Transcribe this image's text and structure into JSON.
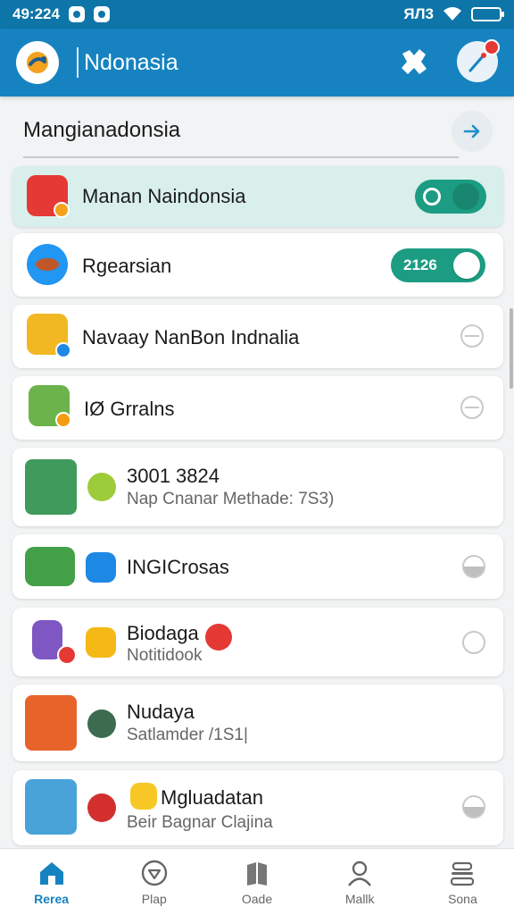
{
  "status": {
    "time": "49:224",
    "network": "ЯЛ3"
  },
  "app": {
    "title": "Ndonasia"
  },
  "search": {
    "text": "Mangianadonsia"
  },
  "list": [
    {
      "label": "Manan Naindonsia",
      "control": "toggle-on"
    },
    {
      "label": "Rgearsian",
      "control": "toggle-version",
      "version": "2126"
    },
    {
      "label": "Navaay NanBon Indnalia",
      "control": "radio-barred"
    },
    {
      "label": "IØ Grralns",
      "control": "radio-barred"
    },
    {
      "label": "3001 3824",
      "sub": "Nap Cnanar Methade: 7S3)"
    },
    {
      "label": "INGICrosas",
      "control": "radio-filled"
    },
    {
      "label": "Biodaga",
      "sub": "Notitidook",
      "control": "radio-empty"
    },
    {
      "label": "Nudaya",
      "sub": "Satlamder /1S1|"
    },
    {
      "label": "Mgluadatan",
      "sub": "Beir Bagnar Clajina",
      "control": "radio-filled"
    }
  ],
  "nav": [
    {
      "label": "Rerea",
      "icon": "home-icon"
    },
    {
      "label": "Plap",
      "icon": "heart-play-icon"
    },
    {
      "label": "Oade",
      "icon": "book-icon"
    },
    {
      "label": "Mallk",
      "icon": "person-icon"
    },
    {
      "label": "Sona",
      "icon": "stack-icon"
    }
  ],
  "colors": {
    "app_bar": "#1683c0",
    "status_bar": "#0d75a8",
    "toggle": "#1c9c82",
    "selected_row": "#d9efec"
  }
}
